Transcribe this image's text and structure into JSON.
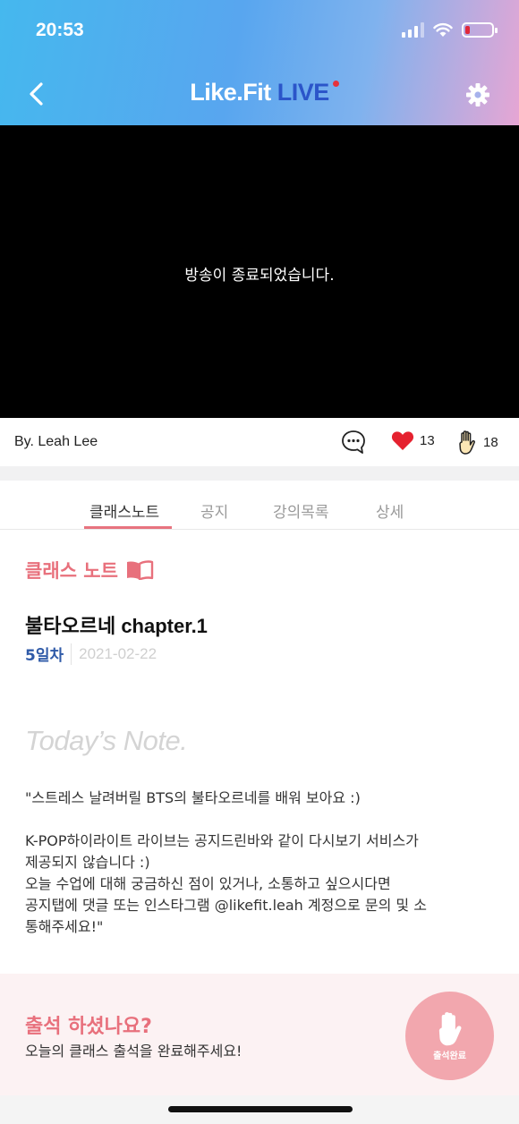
{
  "status_bar": {
    "time": "20:53",
    "battery_color": "#e0283a"
  },
  "header": {
    "title_main": "Like.Fit ",
    "title_live": "LIVE",
    "back_icon": "chevron-left-icon",
    "settings_icon": "gear-icon",
    "gradient_colors": [
      "#45b8ee",
      "#58a6ef",
      "#e6a6d4"
    ]
  },
  "video": {
    "message": "방송이 종료되었습니다."
  },
  "info_bar": {
    "author": "By. Leah Lee",
    "like_count": "13",
    "hand_count": "18",
    "chat_icon": "chat-bubble-icon",
    "like_icon": "heart-icon",
    "hand_icon": "raised-hand-icon"
  },
  "tabs": [
    {
      "label": "클래스노트",
      "active": true
    },
    {
      "label": "공지",
      "active": false
    },
    {
      "label": "강의목록",
      "active": false
    },
    {
      "label": "상세",
      "active": false
    }
  ],
  "class_note": {
    "section_title": "클래스 노트",
    "section_icon": "open-book-icon",
    "title": "불타오르네 chapter.1",
    "day": "5일차",
    "date": "2021-02-22",
    "todays_note_heading": "Today’s Note.",
    "body_paragraph_1": "\"스트레스 날려버릴 BTS의 불타오르네를 배워 보아요 :)",
    "body_paragraph_2": "K-POP하이라이트 라이브는 공지드린바와 같이 다시보기 서비스가\n제공되지 않습니다 :)\n오늘 수업에 대해 궁금하신 점이 있거나, 소통하고 싶으시다면\n공지탭에 댓글 또는 인스타그램 @likefit.leah 계정으로 문의 및 소\n통해주세요!\""
  },
  "attendance": {
    "title": "출석 하셨나요?",
    "subtitle": "오늘의 클래스 출석을 완료해주세요!",
    "button_label": "출석완료",
    "accent_color": "#e8707c"
  }
}
